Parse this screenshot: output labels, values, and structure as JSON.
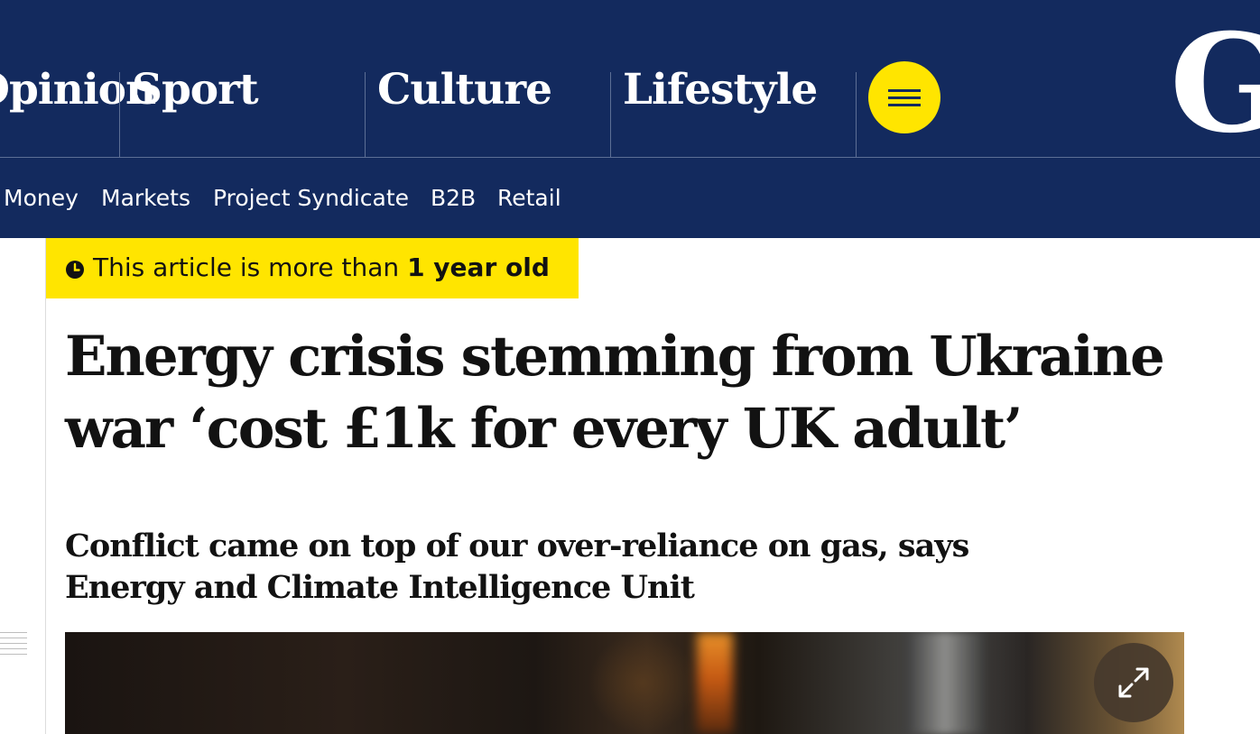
{
  "header": {
    "pillars": [
      {
        "label": "Opinion"
      },
      {
        "label": "Sport"
      },
      {
        "label": "Culture"
      },
      {
        "label": "Lifestyle"
      }
    ],
    "menu_icon": "hamburger-icon",
    "logo_text": "G",
    "subnav": [
      {
        "label": "Money"
      },
      {
        "label": "Markets"
      },
      {
        "label": "Project Syndicate"
      },
      {
        "label": "B2B"
      },
      {
        "label": "Retail"
      }
    ],
    "colors": {
      "brand_background": "#132a5e",
      "menu_button": "#ffe500",
      "text_on_brand": "#ffffff"
    }
  },
  "article": {
    "age_notice": {
      "icon": "clock-icon",
      "prefix": "This article is more than ",
      "emphasis": "1 year old",
      "background": "#ffe500"
    },
    "headline": "Energy crisis stemming from Ukraine war ‘cost £1k for every UK adult’",
    "standfirst": "Conflict came on top of our over-reliance on gas, says Energy and Climate Intelligence Unit",
    "hero_image": {
      "expand_icon": "expand-icon"
    }
  }
}
